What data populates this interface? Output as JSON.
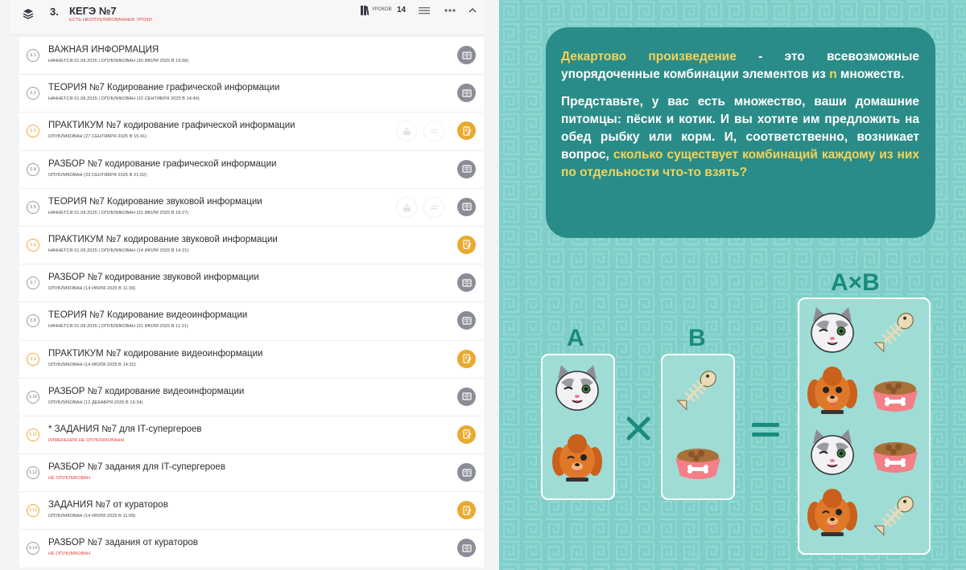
{
  "module": {
    "number": "3.",
    "title": "КЕГЭ №7",
    "warning": "ЕСТЬ НЕОПУБЛИКОВАННЫЕ УРОКИ",
    "lessons_label": "УРОКОВ",
    "lessons_count": "14"
  },
  "lessons": [
    {
      "num": "3.1",
      "title": "ВАЖНАЯ ИНФОРМАЦИЯ",
      "meta": "НАЧНЕТСЯ 01.09.2025  |  ОПУБЛИКОВАН (30 ИЮЛЯ 2025 В 19:56)",
      "kind": "grey"
    },
    {
      "num": "3.2",
      "title": "ТЕОРИЯ №7 Кодирование графической информации",
      "meta": "НАЧНЕТСЯ 01.09.2025  |  ОПУБЛИКОВАН (22 СЕНТЯБРЯ 2025 В 14:49)",
      "kind": "grey"
    },
    {
      "num": "3.3",
      "title": "ПРАКТИКУМ №7 кодирование графической информации",
      "meta": "ОПУБЛИКОВАН (27 СЕНТЯБРЯ 2025 В 15:41)",
      "kind": "gold"
    },
    {
      "num": "3.4",
      "title": "РАЗБОР №7 кодирование графической информации",
      "meta": "ОПУБЛИКОВАН (23 СЕНТЯБРЯ 2025 В 21:02)",
      "kind": "grey"
    },
    {
      "num": "3.5",
      "title": "ТЕОРИЯ №7 Кодирование звуковой информации",
      "meta": "НАЧНЕТСЯ 01.09.2025  |  ОПУБЛИКОВАН (31 ИЮЛЯ 2025 В 18:27)",
      "kind": "grey"
    },
    {
      "num": "3.6",
      "title": "ПРАКТИКУМ №7 кодирование звуковой информации",
      "meta": "НАЧНЕТСЯ 01.09.2025  |  ОПУБЛИКОВАН (14 ИЮЛЯ 2025 В 14:21)",
      "kind": "gold"
    },
    {
      "num": "3.7",
      "title": "РАЗБОР №7 кодирование звуковой информации",
      "meta": "ОПУБЛИКОВАН (14 ИЮЛЯ 2025 В 11:39)",
      "kind": "grey"
    },
    {
      "num": "3.8",
      "title": "ТЕОРИЯ №7 Кодирование видеоинформации",
      "meta": "НАЧНЕТСЯ 01.09.2025  |  ОПУБЛИКОВАН (31 ИЮЛЯ 2025 В 11:21)",
      "kind": "grey"
    },
    {
      "num": "3.9",
      "title": "ПРАКТИКУМ №7 кодирование видеоинформации",
      "meta": "ОПУБЛИКОВАН (14 ИЮЛЯ 2025 В 14:22)",
      "kind": "gold"
    },
    {
      "num": "3.10",
      "title": "РАЗБОР №7 кодирование видеоинформации",
      "meta": "ОПУБЛИКОВАН (12 ДЕКАБРЯ 2025 В 15:34)",
      "kind": "grey"
    },
    {
      "num": "3.11",
      "title": "* ЗАДАНИЯ №7 для IT-супергероев",
      "meta": "ИЗМЕНЕНИЯ НЕ ОПУБЛИКОВАНЫ",
      "kind": "gold",
      "red": true
    },
    {
      "num": "3.12",
      "title": "РАЗБОР №7 задания для IT-супергероев",
      "meta": "НЕ ОПУБЛИКОВАН",
      "kind": "grey",
      "red": true
    },
    {
      "num": "3.13",
      "title": "ЗАДАНИЯ №7 от кураторов",
      "meta": "ОПУБЛИКОВАН (14 ИЮЛЯ 2025 В 11:09)",
      "kind": "gold"
    },
    {
      "num": "3.14",
      "title": "РАЗБОР №7 задания от кураторов",
      "meta": "НЕ ОПУБЛИКОВАН",
      "kind": "grey",
      "red": true
    }
  ],
  "slide": {
    "def_term": "Декартово произведение",
    "def_rest1": " - это всевозможные упорядоченные комбинации элементов из ",
    "def_n": "n",
    "def_rest2": " множеств.",
    "para2_start": "Представьте, у вас есть множество, ваши домашние питомцы: пёсик и котик. И вы хотите им предложить на обед рыбку или корм. И, соответственно, возникает вопрос, ",
    "para2_hl": "сколько существует комбинаций каждому из них по отдельности что-то взять?",
    "set_a_label": "A",
    "set_b_label": "B",
    "product_label": "A×B",
    "times_symbol": "×",
    "equals_symbol": "=",
    "colors": {
      "bubble": "#2a8c88",
      "highlight": "#f3d35a",
      "label": "#1b8a7f",
      "bg": "#7fcfc8"
    }
  }
}
